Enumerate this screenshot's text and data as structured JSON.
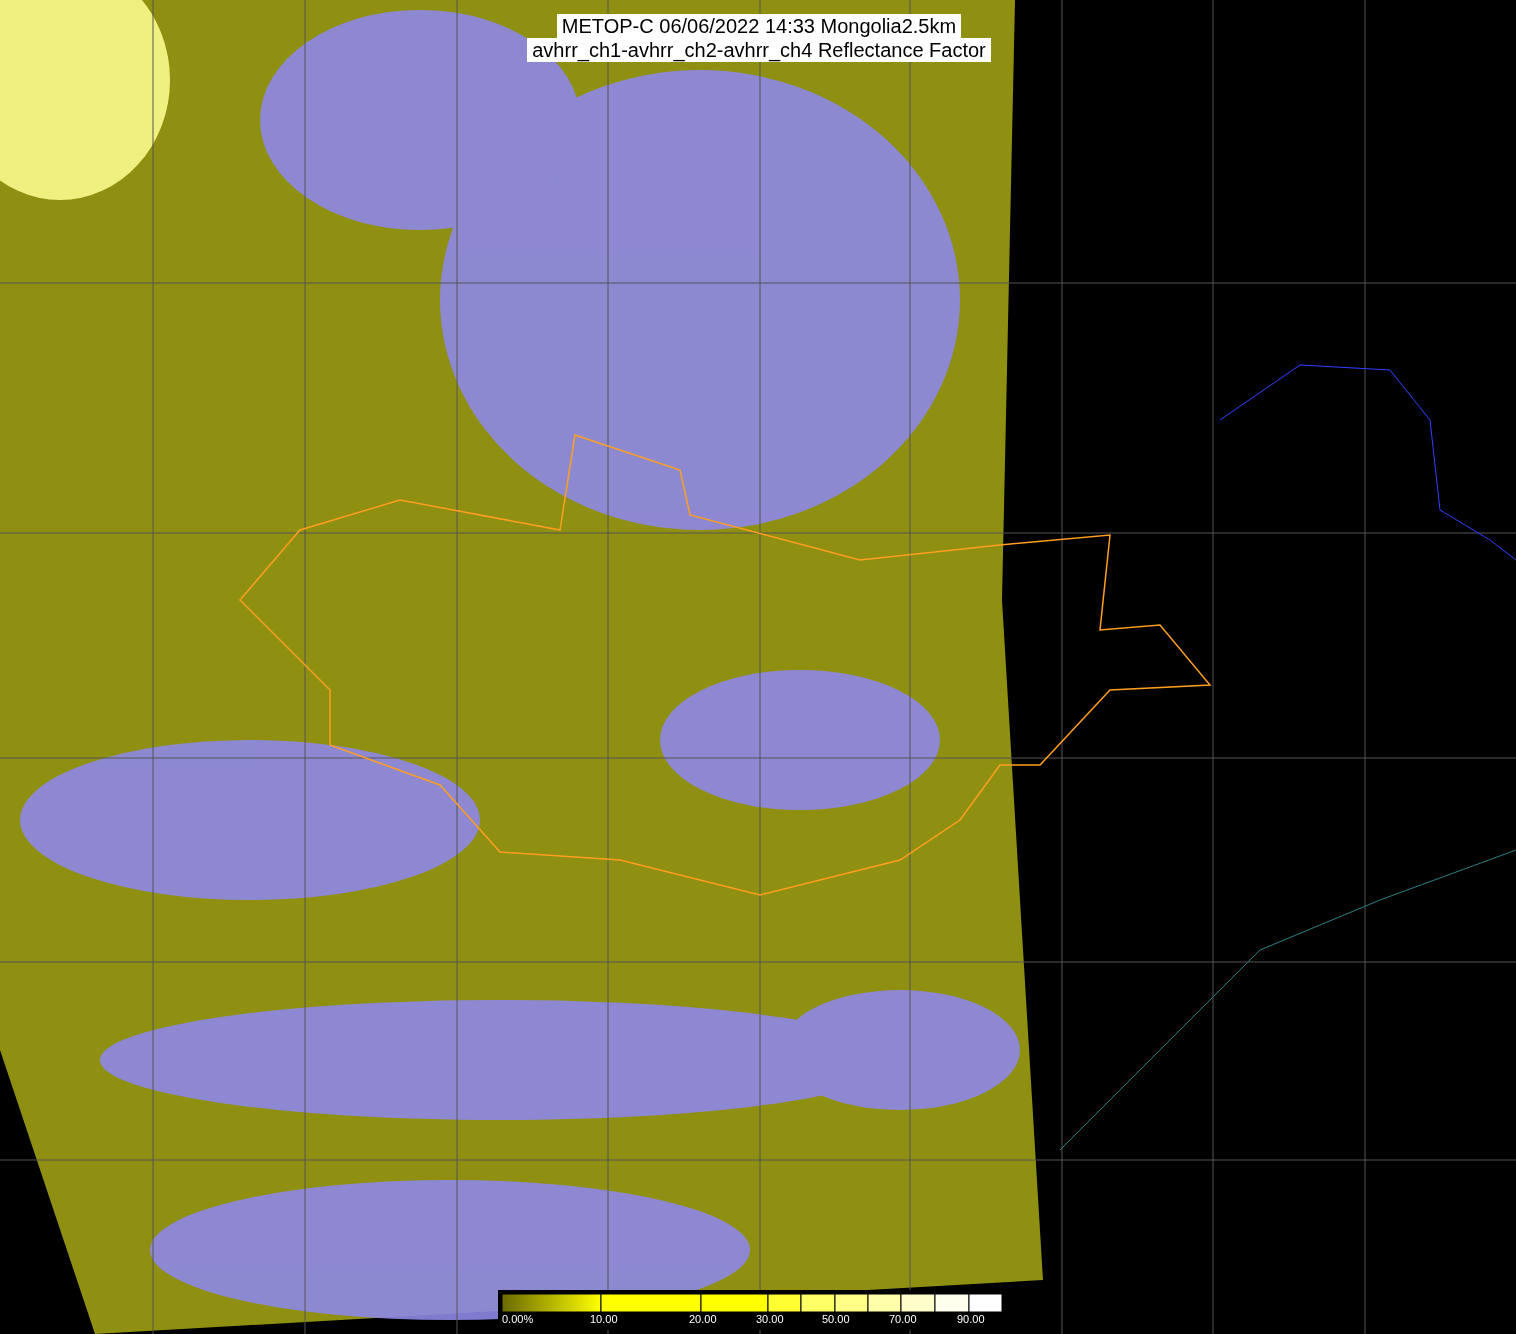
{
  "title_lines": [
    "METOP-C 06/06/2022 14:33 Mongolia2.5km",
    "avhrr_ch1-avhrr_ch2-avhrr_ch4 Reflectance Factor"
  ],
  "colorbar": {
    "labels": [
      "0.00%",
      "10.00",
      "20.00",
      "30.00",
      "50.00",
      "70.00",
      "90.00"
    ]
  }
}
